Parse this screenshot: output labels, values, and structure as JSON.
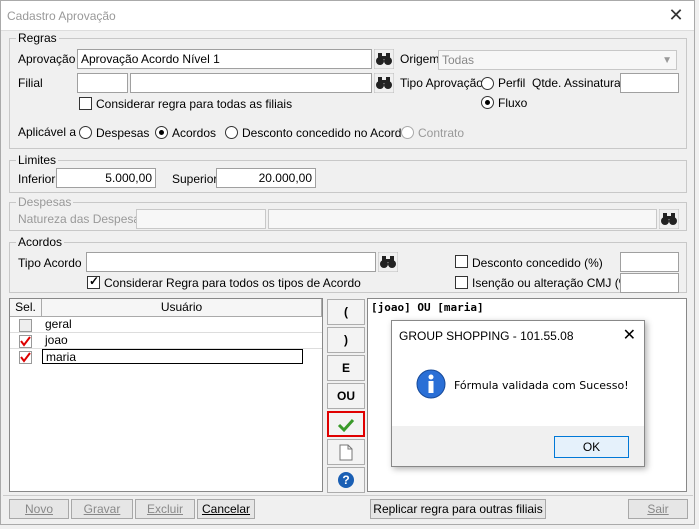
{
  "window": {
    "title": "Cadastro Aprovação",
    "close": "✕"
  },
  "regras": {
    "legend": "Regras",
    "aprovacao_label": "Aprovação",
    "aprovacao_value": "Aprovação Acordo Nível 1",
    "origem_label": "Origem",
    "origem_value": "Todas",
    "filial_label": "Filial",
    "filial_code": "",
    "filial_name": "",
    "tipo_aprovacao_label": "Tipo Aprovação",
    "perfil_label": "Perfil",
    "fluxo_label": "Fluxo",
    "qtde_label": "Qtde. Assinaturas",
    "qtde_value": "",
    "considerar_filiais_label": "Considerar regra para todas as filiais",
    "aplicavel_label": "Aplicável a",
    "aplicavel_options": [
      "Despesas",
      "Acordos",
      "Desconto concedido no Acordo",
      "Contrato"
    ]
  },
  "limites": {
    "legend": "Limites",
    "inferior_label": "Inferior",
    "inferior_value": "5.000,00",
    "superior_label": "Superior",
    "superior_value": "20.000,00"
  },
  "despesas": {
    "legend": "Despesas",
    "natureza_label": "Natureza das Despesas",
    "natureza_code": "",
    "natureza_name": ""
  },
  "acordos": {
    "legend": "Acordos",
    "tipo_acordo_label": "Tipo Acordo",
    "tipo_acordo_value": "",
    "considerar_tipos_label": "Considerar Regra para todos os tipos de Acordo",
    "desconto_label": "Desconto concedido (%)",
    "desconto_value": "",
    "isencao_label": "Isenção ou alteração CMJ (%)",
    "isencao_value": ""
  },
  "grid": {
    "col_sel": "Sel.",
    "col_usuario": "Usuário",
    "rows": [
      {
        "name": "geral",
        "checked": false
      },
      {
        "name": "joao",
        "checked": true
      },
      {
        "name": "maria",
        "checked": true
      }
    ]
  },
  "formula_buttons": [
    "(",
    ")",
    "E",
    "OU"
  ],
  "formula_text": "[joao] OU [maria]",
  "dialog": {
    "title": "GROUP SHOPPING - 101.55.08",
    "close": "✕",
    "message": "Fórmula validada com Sucesso!",
    "ok": "OK"
  },
  "footer": {
    "novo": "Novo",
    "gravar": "Gravar",
    "excluir": "Excluir",
    "cancelar": "Cancelar",
    "replicar": "Replicar regra para outras filiais",
    "sair": "Sair"
  }
}
